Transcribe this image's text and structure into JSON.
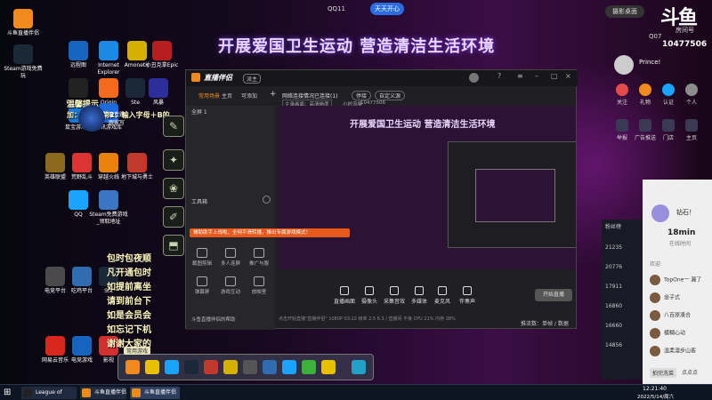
{
  "top": {
    "qq_label": "QQ11",
    "sky_button": "天天开心",
    "rank_button": "摄影桌面",
    "douyu_logo": "斗鱼",
    "room_label": "房间号",
    "room_id": "10477506",
    "q_prefix": "Q07"
  },
  "banner": "开展爱国卫生运动 营造清洁生活环境",
  "desktop_icons": [
    {
      "label": "斗鱼直播伴侣",
      "color": "#f08a1c"
    },
    {
      "label": "Steam游戏免费玩",
      "color": "#1b2838"
    },
    {
      "label": "远程图",
      "color": "#1565c0"
    },
    {
      "label": "Internet Explorer",
      "color": "#1e88e5"
    },
    {
      "label": "Amonetic",
      "color": "#d4b000"
    },
    {
      "label": "小丑克拿Epic",
      "color": "#b81d1d"
    },
    {
      "label": "WeGame",
      "color": "#222"
    },
    {
      "label": "Origin",
      "color": "#f26a1b"
    },
    {
      "label": "Ste",
      "color": "#1b2838"
    },
    {
      "label": "风暴",
      "color": "#2d2d9c"
    },
    {
      "label": "鼠宝游戏星",
      "color": "#1976d2"
    },
    {
      "label": "腾讯游戏库",
      "color": "#1e6ad8"
    },
    {
      "label": "英雄联盟",
      "color": "#8a6a1c"
    },
    {
      "label": "荒野乱斗",
      "color": "#d33"
    },
    {
      "label": "穿越火线",
      "color": "#e8820c"
    },
    {
      "label": "地下城与勇士",
      "color": "#c0392b"
    },
    {
      "label": "QQ",
      "color": "#1aa3ff"
    },
    {
      "label": "Steam免费游戏_领取地址",
      "color": "#3b75c4"
    },
    {
      "label": "电竞平台",
      "color": "#4a4a4a"
    },
    {
      "label": "吃鸡平台",
      "color": "#2f6db0"
    },
    {
      "label": "Ste",
      "color": "#1b2838"
    },
    {
      "label": "网易云音乐",
      "color": "#d8261d"
    },
    {
      "label": "电竞游戏",
      "color": "#1565c0"
    },
    {
      "label": "影视",
      "color": "#d32f2f"
    }
  ],
  "desktop_text": [
    "温馨提示",
    "加：搜索栏第2：输入字母＋B的",
    "包时包夜顺",
    "凡开通包时",
    "如提前离坐",
    "请到前台下",
    "如是会员会",
    "如忘记下机",
    "谢谢大家的"
  ],
  "weather": {
    "label1": "催货题",
    "label2": "跟家写"
  },
  "left_icons": [
    "✎",
    "✦",
    "❀",
    "✐",
    "⬒"
  ],
  "window": {
    "logo": "直播伴侣",
    "badge": "派主",
    "tabs": [
      "常用场景",
      "主页",
      "可添加"
    ],
    "scene": "全屏 1",
    "status": "网络连接情况已连接(1)",
    "status_btn1": "停接",
    "status_btn2": "自定义源",
    "quality": "主录画面：高清晰度",
    "bitrate": "小时流量",
    "room": "10477506",
    "tool_header": "工具箱",
    "tools": [
      "截图剪辑",
      "多人连屏",
      "推广与服",
      "弹幕屏",
      "游戏互动",
      "放映室",
      "斗鱼直播伴侣的帮助"
    ],
    "notice": "辅助助手上线啦，全网平滑转播，推出专属游戏模式！",
    "controls": [
      "直播画面",
      "摄像头",
      "采集音效",
      "多媒体",
      "麦克风",
      "伴奏声"
    ],
    "start": "开始直播",
    "footer": "点击开始直播\"直播伴侣\" 1080P 03:22 帧率 2.5 6.3 / 直播间 不良  CPU 21%  内存 38%",
    "footer_right": "推流数：单帧 / 数据"
  },
  "right_panel": {
    "user": "Prince!",
    "actions": [
      "关注",
      "礼物",
      "认证",
      "个人"
    ],
    "actions2": [
      "举报",
      "广告推送",
      "门店",
      "主页"
    ]
  },
  "fan_panel": {
    "title": "粉丝榜",
    "items": [
      "21235",
      "20776",
      "17911",
      "16860",
      "16660",
      "14856"
    ]
  },
  "chat": {
    "name": "钻石！",
    "duration": "18min",
    "duration_label": "在线时间",
    "section": "欢迎",
    "rows": [
      "TopOne一 漏了",
      "金子式",
      "八百原凑合",
      "模糊心动",
      "温柔漫步山客"
    ],
    "btn1": "拍完洗菜",
    "btn2": "点点点"
  },
  "dock_label": "常用游戏",
  "taskbar": {
    "items": [
      "League of Lege...",
      "斗鱼直播伴侣",
      "斗鱼直播伴侣"
    ],
    "time": "12:21:40",
    "date": "2022/5/14/周六"
  },
  "colors": {
    "accent": "#f08a1c",
    "notice": "#e85a1a",
    "window_bg": "#202024"
  }
}
